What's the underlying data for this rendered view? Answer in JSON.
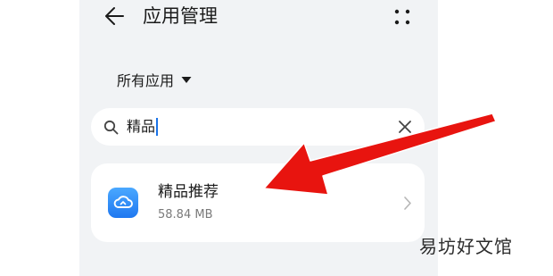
{
  "header": {
    "back_icon": "back-arrow-icon",
    "title": "应用管理",
    "more_icon": "more-dots-icon"
  },
  "filter": {
    "label": "所有应用",
    "icon": "dropdown-triangle-icon"
  },
  "search": {
    "icon": "search-icon",
    "value": "精品",
    "clear_icon": "clear-icon",
    "caret_color": "#1a73e8"
  },
  "results": [
    {
      "name": "精品推荐",
      "size": "58.84 MB",
      "icon": "cloud-app-icon",
      "icon_color": "#2f8cf5"
    }
  ],
  "annotation": {
    "arrow_color": "#e8140f"
  },
  "watermark": "易坊好文馆"
}
